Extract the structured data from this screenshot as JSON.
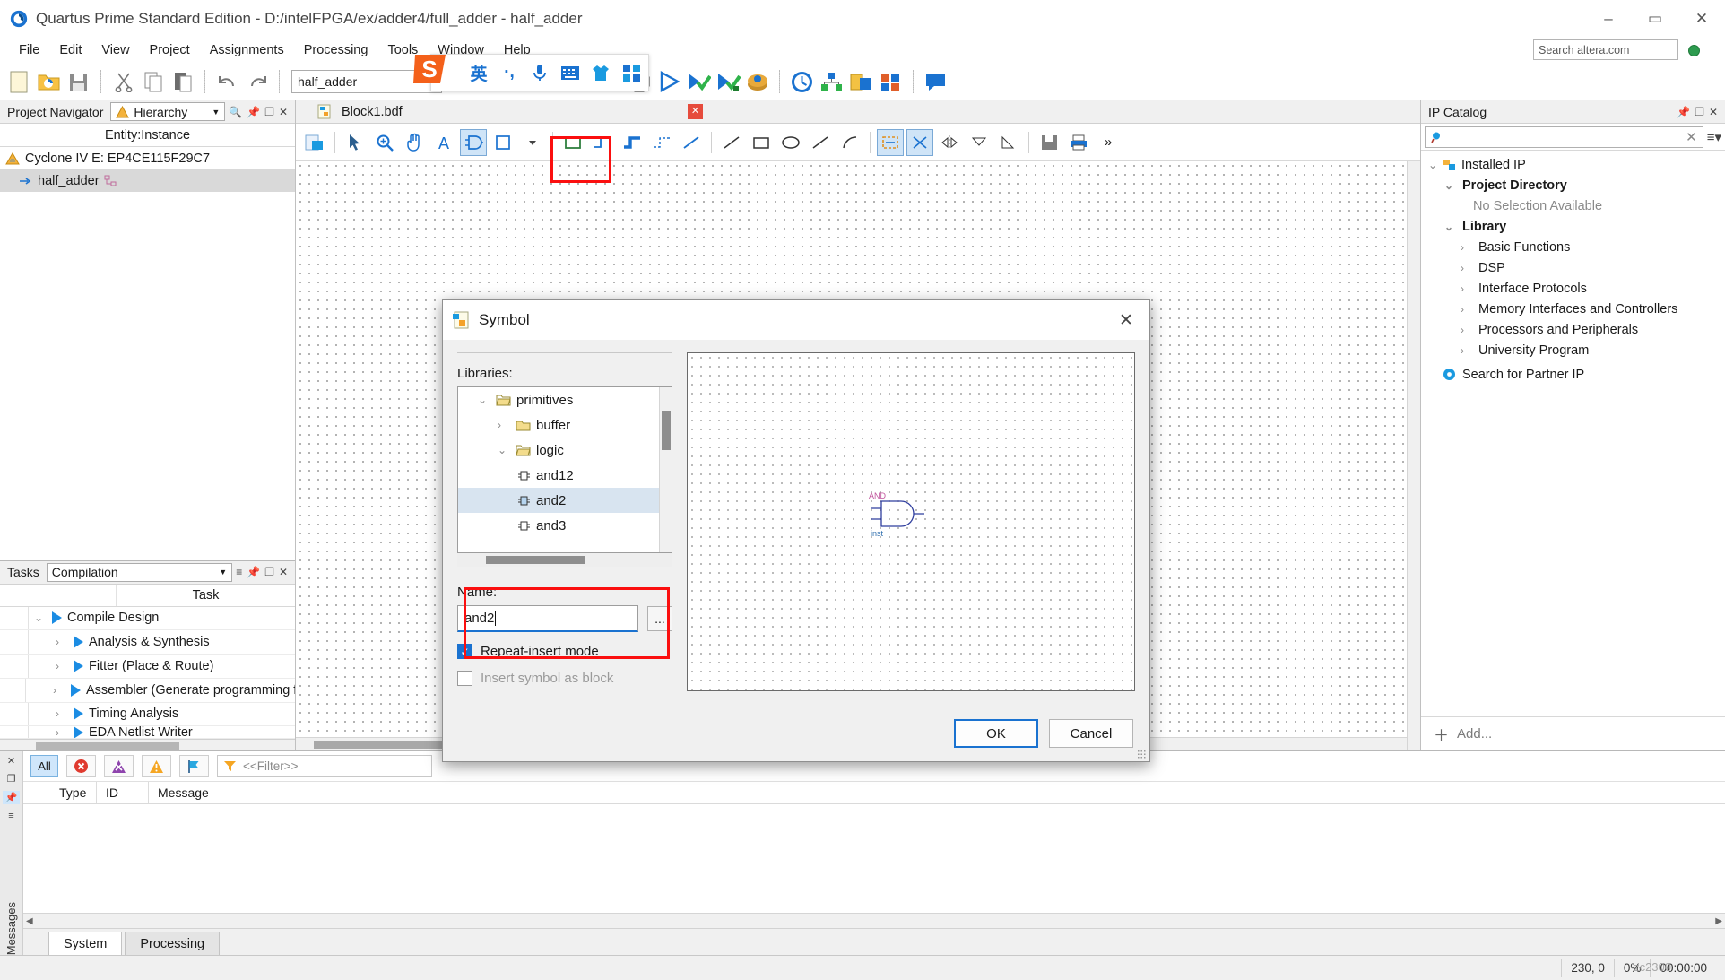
{
  "window": {
    "title": "Quartus Prime Standard Edition - D:/intelFPGA/ex/adder4/full_adder - half_adder",
    "minimize": "–",
    "maximize": "▭",
    "close": "✕"
  },
  "menubar": {
    "items": [
      "File",
      "Edit",
      "View",
      "Project",
      "Assignments",
      "Processing",
      "Tools",
      "Window",
      "Help"
    ],
    "search_placeholder": "Search altera.com"
  },
  "toolbar": {
    "project_name": "half_adder",
    "icons": [
      "new-file-icon",
      "open-folder-icon",
      "save-icon",
      "cut-icon",
      "copy-icon",
      "paste-icon",
      "undo-icon",
      "redo-icon",
      "stop-icon",
      "start-compilation-icon",
      "analysis-synthesis-icon",
      "fitter-icon",
      "assembler-icon",
      "timing-analyzer-icon",
      "programmer-icon",
      "pin-planner-icon",
      "chip-planner-icon",
      "message-icon"
    ]
  },
  "ime": {
    "logo": "S",
    "mode": "英",
    "punctuation": "·,",
    "voice": "voice-input-icon",
    "keyboard": "soft-keyboard-icon",
    "skin": "skin-icon",
    "menu": "ime-menu-icon"
  },
  "project_navigator": {
    "title": "Project Navigator",
    "view": "Hierarchy",
    "column_header": "Entity:Instance",
    "nodes": [
      {
        "label": "Cyclone IV E: EP4CE115F29C7",
        "indent": 0,
        "icon": "device-icon",
        "selected": false
      },
      {
        "label": "half_adder",
        "indent": 1,
        "icon": "entity-icon",
        "selected": true
      }
    ]
  },
  "tasks": {
    "title": "Tasks",
    "flow": "Compilation",
    "column_header": "Task",
    "rows": [
      {
        "label": "Compile Design",
        "indent": 0,
        "expanded": true
      },
      {
        "label": "Analysis & Synthesis",
        "indent": 1,
        "expanded": false
      },
      {
        "label": "Fitter (Place & Route)",
        "indent": 1,
        "expanded": false
      },
      {
        "label": "Assembler (Generate programming files)",
        "indent": 1,
        "expanded": false
      },
      {
        "label": "Timing Analysis",
        "indent": 1,
        "expanded": false
      },
      {
        "label": "EDA Netlist Writer",
        "indent": 1,
        "expanded": false
      }
    ]
  },
  "editor": {
    "tab_label": "Block1.bdf",
    "tab_close": "✕"
  },
  "ip_catalog": {
    "title": "IP Catalog",
    "search_value": "",
    "rows": [
      {
        "label": "Installed IP",
        "indent": 0,
        "arrow": "v",
        "bold": false,
        "icon": "installed-ip-icon",
        "muted": false
      },
      {
        "label": "Project Directory",
        "indent": 1,
        "arrow": "v",
        "bold": true,
        "icon": "",
        "muted": false
      },
      {
        "label": "No Selection Available",
        "indent": 2,
        "arrow": "",
        "bold": false,
        "icon": "",
        "muted": true
      },
      {
        "label": "Library",
        "indent": 1,
        "arrow": "v",
        "bold": true,
        "icon": "",
        "muted": false
      },
      {
        "label": "Basic Functions",
        "indent": 2,
        "arrow": ">",
        "bold": false,
        "icon": "",
        "muted": false
      },
      {
        "label": "DSP",
        "indent": 2,
        "arrow": ">",
        "bold": false,
        "icon": "",
        "muted": false
      },
      {
        "label": "Interface Protocols",
        "indent": 2,
        "arrow": ">",
        "bold": false,
        "icon": "",
        "muted": false
      },
      {
        "label": "Memory Interfaces and Controllers",
        "indent": 2,
        "arrow": ">",
        "bold": false,
        "icon": "",
        "muted": false
      },
      {
        "label": "Processors and Peripherals",
        "indent": 2,
        "arrow": ">",
        "bold": false,
        "icon": "",
        "muted": false
      },
      {
        "label": "University Program",
        "indent": 2,
        "arrow": ">",
        "bold": false,
        "icon": "",
        "muted": false
      },
      {
        "label": "Search for Partner IP",
        "indent": 1,
        "arrow": "",
        "bold": false,
        "icon": "partner-ip-icon",
        "muted": false
      }
    ],
    "add_button": "Add..."
  },
  "messages": {
    "dock_label": "Messages",
    "all_button": "All",
    "filter_placeholder": "<<Filter>>",
    "columns": [
      "Type",
      "ID",
      "Message"
    ],
    "tabs": [
      {
        "label": "System",
        "active": true
      },
      {
        "label": "Processing",
        "active": false
      }
    ]
  },
  "statusbar": {
    "coordinates": "230, 0",
    "progress": "0%",
    "elapsed": "00:00:00",
    "watermark": "zc2300"
  },
  "symbol_dialog": {
    "title": "Symbol",
    "close": "✕",
    "libraries_label": "Libraries:",
    "tree": [
      {
        "label": "primitives",
        "indent": 0,
        "arrow": "v",
        "icon": "folder-open-icon",
        "selected": false
      },
      {
        "label": "buffer",
        "indent": 1,
        "arrow": ">",
        "icon": "folder-closed-icon",
        "selected": false
      },
      {
        "label": "logic",
        "indent": 1,
        "arrow": "v",
        "icon": "folder-open-icon",
        "selected": false
      },
      {
        "label": "and12",
        "indent": 2,
        "arrow": "",
        "icon": "symbol-icon",
        "selected": false
      },
      {
        "label": "and2",
        "indent": 2,
        "arrow": "",
        "icon": "symbol-icon",
        "selected": true
      },
      {
        "label": "and3",
        "indent": 2,
        "arrow": "",
        "icon": "symbol-icon",
        "selected": false
      }
    ],
    "name_label": "Name:",
    "name_value": "and2",
    "browse_button": "...",
    "repeat_insert_label": "Repeat-insert mode",
    "repeat_insert_checked": true,
    "insert_as_block_label": "Insert symbol as block",
    "insert_as_block_checked": false,
    "preview_symbol_label": "AND",
    "preview_instance_label": "inst",
    "ok_button": "OK",
    "cancel_button": "Cancel"
  },
  "colors": {
    "accent": "#1a72d0",
    "annotation": "#fb0f0f",
    "selection": "#d8e4f0",
    "tab_close": "#e64b3c"
  }
}
